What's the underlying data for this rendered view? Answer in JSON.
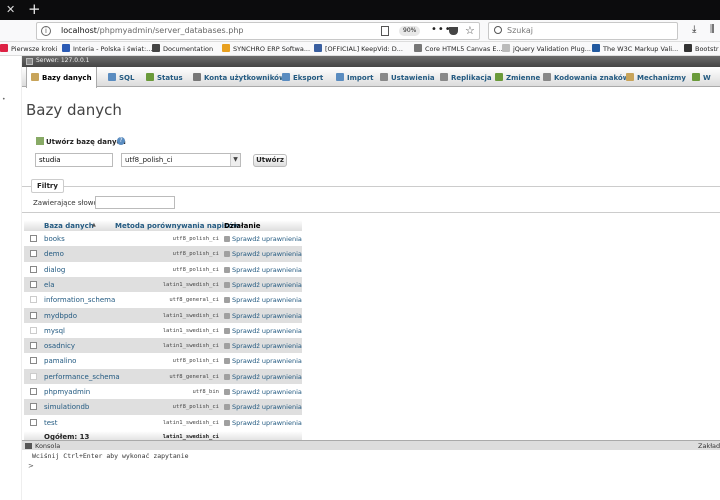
{
  "browser": {
    "url_host": "localhost",
    "url_path": "/phpmyadmin/server_databases.php",
    "zoom": "90%",
    "search_placeholder": "Szukaj",
    "tab_close": "✕",
    "new_tab": "+",
    "bookmarks": [
      {
        "label": "Pierwsze kroki",
        "color": "#d24"
      },
      {
        "label": "Interia - Polska i świat:...",
        "color": "#2b5bb5"
      },
      {
        "label": "Documentation",
        "color": "#444"
      },
      {
        "label": "SYNCHRO ERP Softwa...",
        "color": "#e8a020"
      },
      {
        "label": "[OFFICIAL] KeepVid: D...",
        "color": "#3a5fa0"
      },
      {
        "label": "Core HTML5 Canvas E...",
        "color": "#777"
      },
      {
        "label": "jQuery Validation Plug...",
        "color": "#bbb"
      },
      {
        "label": "The W3C Markup Vali...",
        "color": "#225aa0"
      },
      {
        "label": "Bootstr",
        "color": "#333"
      }
    ]
  },
  "server": {
    "label": "Serwer: 127.0.0.1"
  },
  "tabs": [
    {
      "label": "Bazy danych",
      "active": true,
      "color": "#c8a45a"
    },
    {
      "label": "SQL",
      "active": false,
      "color": "#5a8cc0"
    },
    {
      "label": "Status",
      "active": false,
      "color": "#6a9a3a"
    },
    {
      "label": "Konta użytkowników",
      "active": false,
      "color": "#777"
    },
    {
      "label": "Eksport",
      "active": false,
      "color": "#5a8cc0"
    },
    {
      "label": "Import",
      "active": false,
      "color": "#5a8cc0"
    },
    {
      "label": "Ustawienia",
      "active": false,
      "color": "#888"
    },
    {
      "label": "Replikacja",
      "active": false,
      "color": "#888"
    },
    {
      "label": "Zmienne",
      "active": false,
      "color": "#6a9a3a"
    },
    {
      "label": "Kodowania znaków",
      "active": false,
      "color": "#888"
    },
    {
      "label": "Mechanizmy",
      "active": false,
      "color": "#c8a45a"
    },
    {
      "label": "W",
      "active": false,
      "color": "#6a9a3a"
    }
  ],
  "page": {
    "title": "Bazy danych",
    "create_label": "Utwórz bazę danych",
    "db_name_value": "studia",
    "collation_value": "utf8_polish_ci",
    "create_button": "Utwórz",
    "filter_legend": "Filtry",
    "filter_label": "Zawierające słowo:",
    "filter_value": ""
  },
  "table": {
    "headers": {
      "name": "Baza danych",
      "collation": "Metoda porównywania napisów",
      "action": "Działanie"
    },
    "rows": [
      {
        "name": "books",
        "collation": "utf8_polish_ci",
        "action": "Sprawdź uprawnienia",
        "system": false
      },
      {
        "name": "demo",
        "collation": "utf8_polish_ci",
        "action": "Sprawdź uprawnienia",
        "system": false
      },
      {
        "name": "dialog",
        "collation": "utf8_polish_ci",
        "action": "Sprawdź uprawnienia",
        "system": false
      },
      {
        "name": "ela",
        "collation": "latin1_swedish_ci",
        "action": "Sprawdź uprawnienia",
        "system": false
      },
      {
        "name": "information_schema",
        "collation": "utf8_general_ci",
        "action": "Sprawdź uprawnienia",
        "system": true
      },
      {
        "name": "mydbpdo",
        "collation": "latin1_swedish_ci",
        "action": "Sprawdź uprawnienia",
        "system": false
      },
      {
        "name": "mysql",
        "collation": "latin1_swedish_ci",
        "action": "Sprawdź uprawnienia",
        "system": true
      },
      {
        "name": "osadnicy",
        "collation": "latin1_swedish_ci",
        "action": "Sprawdź uprawnienia",
        "system": false
      },
      {
        "name": "pamalino",
        "collation": "utf8_polish_ci",
        "action": "Sprawdź uprawnienia",
        "system": false
      },
      {
        "name": "performance_schema",
        "collation": "utf8_general_ci",
        "action": "Sprawdź uprawnienia",
        "system": true
      },
      {
        "name": "phpmyadmin",
        "collation": "utf8_bin",
        "action": "Sprawdź uprawnienia",
        "system": false
      },
      {
        "name": "simulationdb",
        "collation": "utf8_polish_ci",
        "action": "Sprawdź uprawnienia",
        "system": false
      },
      {
        "name": "test",
        "collation": "latin1_swedish_ci",
        "action": "Sprawdź uprawnienia",
        "system": false
      }
    ],
    "total_label": "Ogółem: 13",
    "total_collation": "latin1_swedish_ci"
  },
  "console": {
    "label": "Konsola",
    "right_label": "Zakładk",
    "hint": "Wciśnij Ctrl+Enter aby wykonać zapytanie",
    "prompt": ">"
  }
}
